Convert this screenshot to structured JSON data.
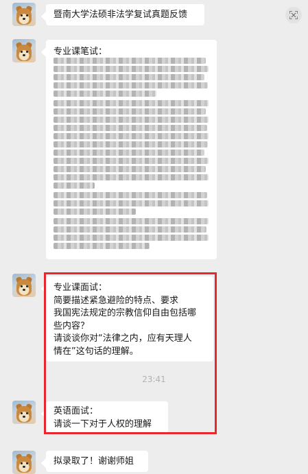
{
  "messages": {
    "title_msg": "暨南大学法硕非法学复试真题反馈",
    "written_header": "专业课笔试：",
    "interview": {
      "lines": [
        "专业课面试：",
        "简要描述紧急避险的特点、要求",
        "我国宪法规定的宗教信仰自由包括哪",
        "些内容？",
        "请谈谈你对“法律之内，应有天理人",
        "情在”这句话的理解。"
      ]
    },
    "timestamp": "23:41",
    "english": {
      "lines": [
        "英语面试：",
        "请谈一下对于人权的理解"
      ]
    },
    "final": "拟录取了！谢谢师姐"
  },
  "colors": {
    "background": "#ededed",
    "bubble": "#ffffff",
    "highlight": "#e7262d"
  },
  "icons": {
    "scan": "scan-icon",
    "avatar": "shiba-dog-avatar"
  }
}
